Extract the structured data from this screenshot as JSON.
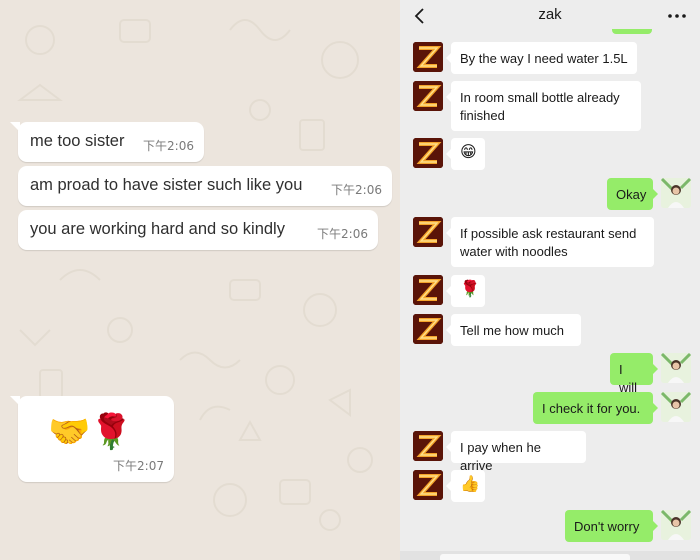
{
  "left_chat": {
    "messages": [
      {
        "text": "me too sister",
        "time": "下午2:06"
      },
      {
        "text": "am proad to have sister such like you",
        "time": "下午2:06"
      },
      {
        "text": "you are working hard and so kindly",
        "time": "下午2:06"
      }
    ],
    "emoji_message": {
      "emojis": "🤝🌹",
      "time": "下午2:07"
    }
  },
  "right_chat": {
    "header": {
      "title": "zak",
      "back_icon": "chevron-left-icon",
      "more_icon": "more-dots-icon"
    },
    "colors": {
      "outgoing": "#95ec69",
      "incoming": "#ffffff",
      "background": "#ededed"
    },
    "messages": [
      {
        "from": "zak",
        "text": "By the way I need water 1.5L"
      },
      {
        "from": "zak",
        "text": "In room small bottle already finished"
      },
      {
        "from": "zak",
        "text": "😁"
      },
      {
        "from": "me",
        "text": "Okay"
      },
      {
        "from": "zak",
        "text": "If possible ask restaurant send water with noodles"
      },
      {
        "from": "zak",
        "text": "🌹"
      },
      {
        "from": "zak",
        "text": "Tell me how much"
      },
      {
        "from": "me",
        "text": "I will"
      },
      {
        "from": "me",
        "text": "I check it for you."
      },
      {
        "from": "zak",
        "text": "I pay when he arrive"
      },
      {
        "from": "zak",
        "text": "👍"
      },
      {
        "from": "me",
        "text": "Don't worry"
      }
    ]
  }
}
